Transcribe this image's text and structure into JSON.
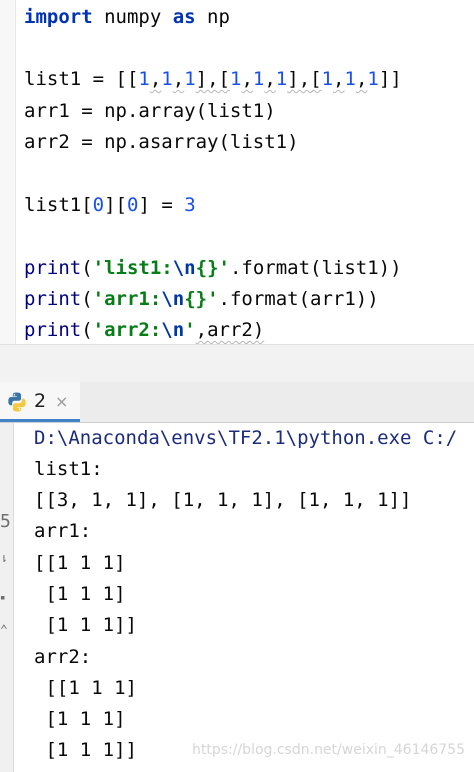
{
  "editor": {
    "lines": {
      "l1": {
        "import": "import",
        "mod": " numpy ",
        "as": "as",
        "alias": " np"
      },
      "l3": {
        "a": "list1 = [[",
        "n1": "1",
        "c1": ",",
        "n2": "1",
        "c2": ",",
        "n3": "1",
        "b1": "],[",
        "n4": "1",
        "c3": ",",
        "n5": "1",
        "c4": ",",
        "n6": "1",
        "b2": "],[",
        "n7": "1",
        "c5": ",",
        "n8": "1",
        "c6": ",",
        "n9": "1",
        "end": "]]"
      },
      "l4": "arr1 = np.array(list1)",
      "l5": "arr2 = np.asarray(list1)",
      "l7": {
        "a": "list1[",
        "i0": "0",
        "b": "][",
        "j0": "0",
        "c": "] = ",
        "v": "3"
      },
      "l9": {
        "fn": "print",
        "p": "(",
        "s1": "'list1:",
        "esc": "\\n",
        "s2": "{}'",
        "rest": ".format(list1))"
      },
      "l10": {
        "fn": "print",
        "p": "(",
        "s1": "'arr1:",
        "esc": "\\n",
        "s2": "{}'",
        "rest": ".format(arr1))"
      },
      "l11": {
        "fn": "print",
        "p": "(",
        "s1": "'arr2:",
        "esc": "\\n",
        "s2": "'",
        "rest": ",arr2)"
      }
    }
  },
  "run_panel": {
    "tab_label": "2",
    "close_glyph": "×",
    "icon": "python-icon"
  },
  "console": {
    "lines": [
      "D:\\Anaconda\\envs\\TF2.1\\python.exe C:/",
      "list1:",
      "[[3, 1, 1], [1, 1, 1], [1, 1, 1]]",
      "arr1:",
      "[[1 1 1]",
      " [1 1 1]",
      " [1 1 1]]",
      "arr2:",
      " [[1 1 1]",
      " [1 1 1]",
      " [1 1 1]]"
    ],
    "watermark": "https://blog.csdn.net/weixin_46146755",
    "gutter_glyphs": [
      "5",
      "⇂",
      "▪",
      "⌃"
    ]
  },
  "colors": {
    "keyword": "#0033b3",
    "number": "#1750eb",
    "string": "#067d17",
    "tab_accent": "#4083c9"
  }
}
